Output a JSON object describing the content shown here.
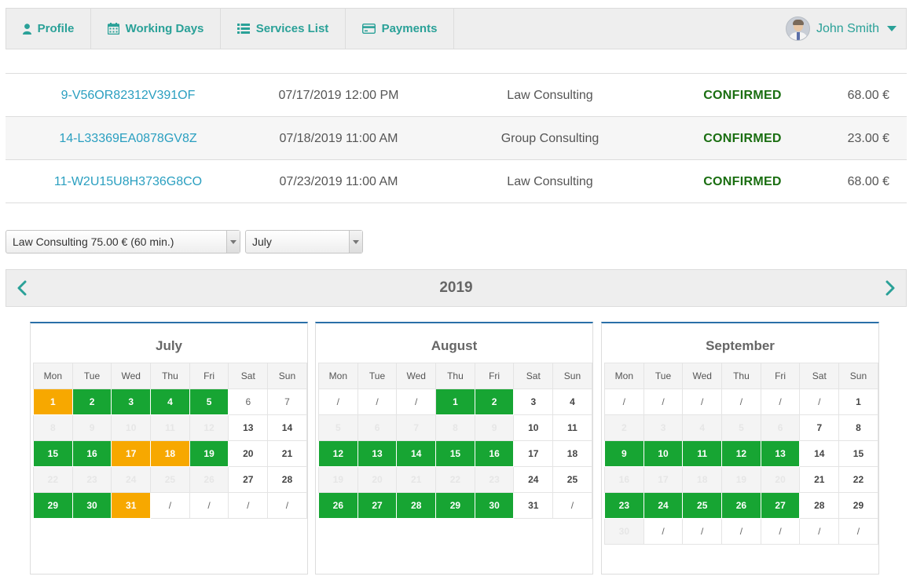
{
  "nav": {
    "items": [
      {
        "label": "Profile",
        "icon": "user-icon"
      },
      {
        "label": "Working Days",
        "icon": "calendar-icon"
      },
      {
        "label": "Services List",
        "icon": "list-icon"
      },
      {
        "label": "Payments",
        "icon": "credit-card-icon"
      }
    ],
    "user_name": "John Smith"
  },
  "bookings": [
    {
      "id": "9-V56OR82312V391OF",
      "date": "07/17/2019 12:00 PM",
      "service": "Law Consulting",
      "status": "CONFIRMED",
      "price": "68.00 €"
    },
    {
      "id": "14-L33369EA0878GV8Z",
      "date": "07/18/2019 11:00 AM",
      "service": "Group Consulting",
      "status": "CONFIRMED",
      "price": "23.00 €"
    },
    {
      "id": "11-W2U15U8H3736G8CO",
      "date": "07/23/2019 11:00 AM",
      "service": "Law Consulting",
      "status": "CONFIRMED",
      "price": "68.00 €"
    }
  ],
  "filters": {
    "service_selected": "Law Consulting 75.00 € (60 min.)",
    "month_selected": "July"
  },
  "year": "2019",
  "weekdays": [
    "Mon",
    "Tue",
    "Wed",
    "Thu",
    "Fri",
    "Sat",
    "Sun"
  ],
  "colors": {
    "available": "#17a533",
    "booked": "#f7a800",
    "link": "#2a9fc0",
    "accent": "#2aa198",
    "confirmed": "#1a6e11"
  },
  "months": [
    {
      "name": "July",
      "weeks": [
        [
          {
            "d": "1",
            "s": "o"
          },
          {
            "d": "2",
            "s": "g"
          },
          {
            "d": "3",
            "s": "g"
          },
          {
            "d": "4",
            "s": "g"
          },
          {
            "d": "5",
            "s": "g"
          },
          {
            "d": "6",
            "s": "s"
          },
          {
            "d": "7",
            "s": "s"
          }
        ],
        [
          {
            "d": "8",
            "s": "x"
          },
          {
            "d": "9",
            "s": "x"
          },
          {
            "d": "10",
            "s": "x"
          },
          {
            "d": "11",
            "s": "x"
          },
          {
            "d": "12",
            "s": "x"
          },
          {
            "d": "13",
            "s": "n"
          },
          {
            "d": "14",
            "s": "n"
          }
        ],
        [
          {
            "d": "15",
            "s": "g"
          },
          {
            "d": "16",
            "s": "g"
          },
          {
            "d": "17",
            "s": "o"
          },
          {
            "d": "18",
            "s": "o"
          },
          {
            "d": "19",
            "s": "g"
          },
          {
            "d": "20",
            "s": "n"
          },
          {
            "d": "21",
            "s": "n"
          }
        ],
        [
          {
            "d": "22",
            "s": "x"
          },
          {
            "d": "23",
            "s": "x"
          },
          {
            "d": "24",
            "s": "x"
          },
          {
            "d": "25",
            "s": "x"
          },
          {
            "d": "26",
            "s": "x"
          },
          {
            "d": "27",
            "s": "n"
          },
          {
            "d": "28",
            "s": "n"
          }
        ],
        [
          {
            "d": "29",
            "s": "g"
          },
          {
            "d": "30",
            "s": "g"
          },
          {
            "d": "31",
            "s": "o"
          },
          {
            "d": "/",
            "s": "s"
          },
          {
            "d": "/",
            "s": "s"
          },
          {
            "d": "/",
            "s": "s"
          },
          {
            "d": "/",
            "s": "s"
          }
        ]
      ]
    },
    {
      "name": "August",
      "weeks": [
        [
          {
            "d": "/",
            "s": "s"
          },
          {
            "d": "/",
            "s": "s"
          },
          {
            "d": "/",
            "s": "s"
          },
          {
            "d": "1",
            "s": "g"
          },
          {
            "d": "2",
            "s": "g"
          },
          {
            "d": "3",
            "s": "n"
          },
          {
            "d": "4",
            "s": "n"
          }
        ],
        [
          {
            "d": "5",
            "s": "x"
          },
          {
            "d": "6",
            "s": "x"
          },
          {
            "d": "7",
            "s": "x"
          },
          {
            "d": "8",
            "s": "x"
          },
          {
            "d": "9",
            "s": "x"
          },
          {
            "d": "10",
            "s": "n"
          },
          {
            "d": "11",
            "s": "n"
          }
        ],
        [
          {
            "d": "12",
            "s": "g"
          },
          {
            "d": "13",
            "s": "g"
          },
          {
            "d": "14",
            "s": "g"
          },
          {
            "d": "15",
            "s": "g"
          },
          {
            "d": "16",
            "s": "g"
          },
          {
            "d": "17",
            "s": "n"
          },
          {
            "d": "18",
            "s": "n"
          }
        ],
        [
          {
            "d": "19",
            "s": "x"
          },
          {
            "d": "20",
            "s": "x"
          },
          {
            "d": "21",
            "s": "x"
          },
          {
            "d": "22",
            "s": "x"
          },
          {
            "d": "23",
            "s": "x"
          },
          {
            "d": "24",
            "s": "n"
          },
          {
            "d": "25",
            "s": "n"
          }
        ],
        [
          {
            "d": "26",
            "s": "g"
          },
          {
            "d": "27",
            "s": "g"
          },
          {
            "d": "28",
            "s": "g"
          },
          {
            "d": "29",
            "s": "g"
          },
          {
            "d": "30",
            "s": "g"
          },
          {
            "d": "31",
            "s": "n"
          },
          {
            "d": "/",
            "s": "s"
          }
        ]
      ]
    },
    {
      "name": "September",
      "weeks": [
        [
          {
            "d": "/",
            "s": "s"
          },
          {
            "d": "/",
            "s": "s"
          },
          {
            "d": "/",
            "s": "s"
          },
          {
            "d": "/",
            "s": "s"
          },
          {
            "d": "/",
            "s": "s"
          },
          {
            "d": "/",
            "s": "s"
          },
          {
            "d": "1",
            "s": "n"
          }
        ],
        [
          {
            "d": "2",
            "s": "x"
          },
          {
            "d": "3",
            "s": "x"
          },
          {
            "d": "4",
            "s": "x"
          },
          {
            "d": "5",
            "s": "x"
          },
          {
            "d": "6",
            "s": "x"
          },
          {
            "d": "7",
            "s": "n"
          },
          {
            "d": "8",
            "s": "n"
          }
        ],
        [
          {
            "d": "9",
            "s": "g"
          },
          {
            "d": "10",
            "s": "g"
          },
          {
            "d": "11",
            "s": "g"
          },
          {
            "d": "12",
            "s": "g"
          },
          {
            "d": "13",
            "s": "g"
          },
          {
            "d": "14",
            "s": "n"
          },
          {
            "d": "15",
            "s": "n"
          }
        ],
        [
          {
            "d": "16",
            "s": "x"
          },
          {
            "d": "17",
            "s": "x"
          },
          {
            "d": "18",
            "s": "x"
          },
          {
            "d": "19",
            "s": "x"
          },
          {
            "d": "20",
            "s": "x"
          },
          {
            "d": "21",
            "s": "n"
          },
          {
            "d": "22",
            "s": "n"
          }
        ],
        [
          {
            "d": "23",
            "s": "g"
          },
          {
            "d": "24",
            "s": "g"
          },
          {
            "d": "25",
            "s": "g"
          },
          {
            "d": "26",
            "s": "g"
          },
          {
            "d": "27",
            "s": "g"
          },
          {
            "d": "28",
            "s": "n"
          },
          {
            "d": "29",
            "s": "n"
          }
        ],
        [
          {
            "d": "30",
            "s": "x"
          },
          {
            "d": "/",
            "s": "s"
          },
          {
            "d": "/",
            "s": "s"
          },
          {
            "d": "/",
            "s": "s"
          },
          {
            "d": "/",
            "s": "s"
          },
          {
            "d": "/",
            "s": "s"
          },
          {
            "d": "/",
            "s": "s"
          }
        ]
      ]
    }
  ]
}
